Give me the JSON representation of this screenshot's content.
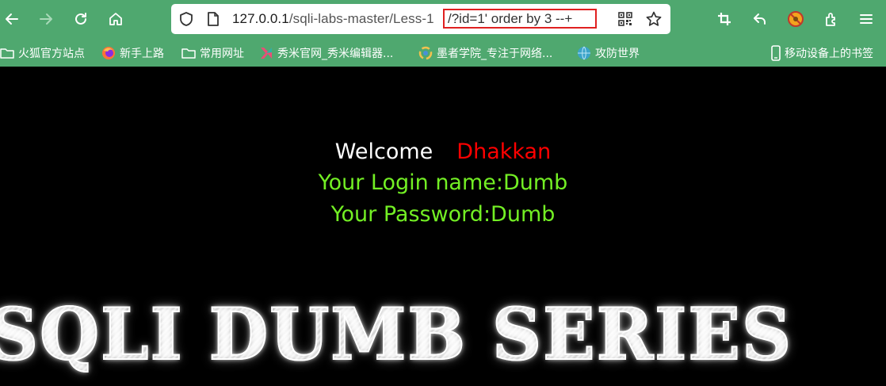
{
  "browser": {
    "url_host": "127.0.0.1",
    "url_path": "/sqli-labs-master/Less-1",
    "url_query": "/?id=1' order by 3 --+",
    "highlight_color": "#e02020",
    "toolbar_color": "#4fa86f"
  },
  "nav": {
    "back_icon": "arrow-left-icon",
    "forward_icon": "arrow-right-icon",
    "reload_icon": "reload-icon",
    "home_icon": "home-icon"
  },
  "toolbar_right": {
    "icons": [
      "crop-icon",
      "undo-icon",
      "blocked-icon",
      "extensions-icon",
      "menu-icon"
    ]
  },
  "bookmarks": [
    {
      "label": "火狐官方站点",
      "icon": "folder-icon"
    },
    {
      "label": "新手上路",
      "icon": "firefox-icon"
    },
    {
      "label": "常用网址",
      "icon": "folder-icon"
    },
    {
      "label": "秀米官网_秀米编辑器...",
      "icon": "xiumi-icon"
    },
    {
      "label": "墨者学院_专注于网络...",
      "icon": "mozhe-icon"
    },
    {
      "label": "攻防世界",
      "icon": "globe-icon"
    },
    {
      "label": "移动设备上的书签",
      "icon": "mobile-icon"
    }
  ],
  "page": {
    "welcome": "Welcome",
    "name": "Dhakkan",
    "login_line": "Your Login name:Dumb",
    "password_line": "Your Password:Dumb",
    "banner": "SQLI DUMB SERIES",
    "welcome_color": "#ffffff",
    "name_color": "#ff0000",
    "info_color": "#73ef24"
  }
}
